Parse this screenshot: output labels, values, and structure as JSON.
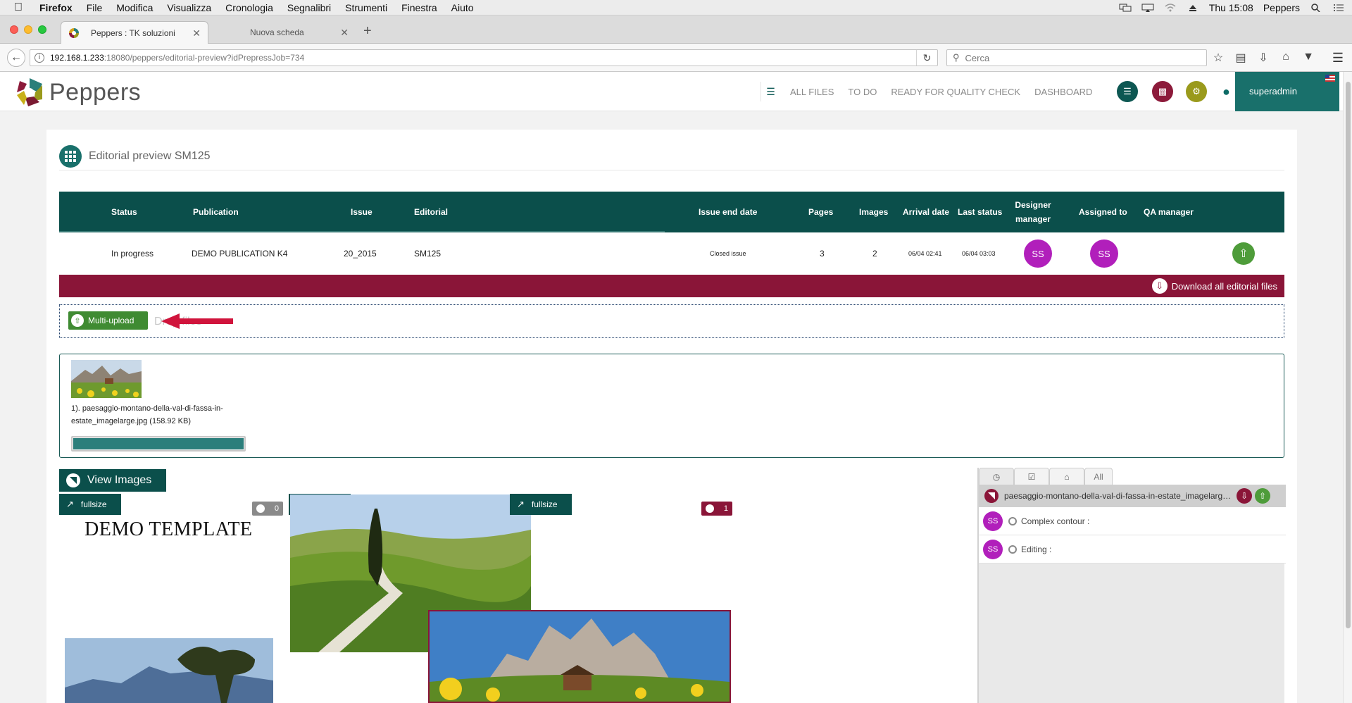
{
  "os_menubar": {
    "app": "Firefox",
    "items": [
      "File",
      "Modifica",
      "Visualizza",
      "Cronologia",
      "Segnalibri",
      "Strumenti",
      "Finestra",
      "Aiuto"
    ],
    "clock": "Thu 15:08",
    "user": "Peppers"
  },
  "browser": {
    "tabs": [
      {
        "label": "Peppers : TK soluzioni"
      },
      {
        "label": "Nuova scheda"
      }
    ],
    "url_host": "192.168.1.233",
    "url_path": ":18080/peppers/editorial-preview?idPrepressJob=734",
    "search_placeholder": "Cerca"
  },
  "app": {
    "logo_text": "Peppers",
    "nav": [
      "ALL FILES",
      "TO DO",
      "READY FOR QUALITY CHECK",
      "DASHBOARD"
    ],
    "user": "superadmin",
    "colors": {
      "teal": "#0b4f4b",
      "maroon": "#8a1538",
      "olive": "#9a9a1c",
      "green": "#4e9c3a",
      "avatar": "#b11fbb"
    }
  },
  "page": {
    "title": "Editorial preview SM125",
    "table": {
      "headers": [
        "Status",
        "Publication",
        "Issue",
        "Editorial",
        "Issue end date",
        "Pages",
        "Images",
        "Arrival date",
        "Last status",
        "Designer manager",
        "Assigned to",
        "QA manager"
      ],
      "row": {
        "status": "In progress",
        "publication": "DEMO PUBLICATION K4",
        "issue": "20_2015",
        "editorial": "SM125",
        "issue_end_date": "Closed issue",
        "pages": "3",
        "images": "2",
        "arrival_date": "06/04 02:41",
        "last_status": "06/04 03:03",
        "designer_manager": "SS",
        "assigned_to": "SS"
      }
    },
    "download_all": "Download all editorial files",
    "multi_upload": "Multi-upload",
    "drop_hint": "Drop files",
    "upload_file": {
      "name": "1). paesaggio-montano-della-val-di-fassa-in-estate_imagelarge.jpg (158.92 KB)",
      "progress": 1.0
    },
    "view_images": "View Images",
    "fullsize_label": "fullsize",
    "badges": [
      "0",
      "1",
      "1"
    ],
    "demo_template": "DEMO TEMPLATE"
  },
  "side_panel": {
    "tabs": [
      "clock-icon",
      "check-icon",
      "home-icon",
      "All"
    ],
    "file": "paesaggio-montano-della-val-di-fassa-in-estate_imagelarge.jpg",
    "rows": [
      {
        "avatar": "SS",
        "label": "Complex contour :"
      },
      {
        "avatar": "SS",
        "label": "Editing :"
      }
    ]
  }
}
